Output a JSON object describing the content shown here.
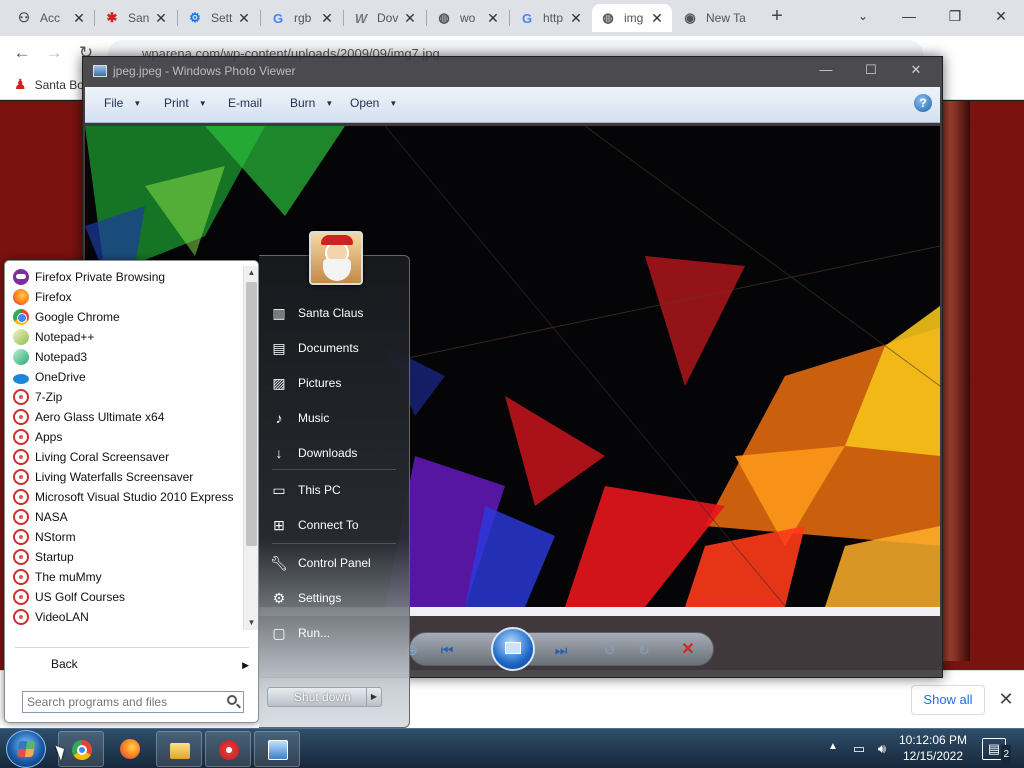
{
  "browser": {
    "tabs": [
      {
        "label": "Acc",
        "icon": "account-icon"
      },
      {
        "label": "San",
        "icon": "santa-icon"
      },
      {
        "label": "Sett",
        "icon": "settings-gear-icon"
      },
      {
        "label": "rgb",
        "icon": "google-icon"
      },
      {
        "label": "Dov",
        "icon": "wordpress-icon"
      },
      {
        "label": "wo",
        "icon": "globe-icon"
      },
      {
        "label": "http",
        "icon": "google-icon"
      },
      {
        "label": "img",
        "icon": "globe-icon",
        "active": true
      },
      {
        "label": "New Ta",
        "icon": "chrome-icon"
      }
    ],
    "url": "wparena.com/wp-content/uploads/2009/09/img7.jpg",
    "bookmark": "Santa Bo",
    "show_all": "Show all"
  },
  "photo_viewer": {
    "title": "jpeg.jpeg - Windows Photo Viewer",
    "menus": [
      "File",
      "Print",
      "E-mail",
      "Burn",
      "Open"
    ],
    "help": "?"
  },
  "start_menu": {
    "programs": [
      {
        "label": "Firefox Private Browsing",
        "icon": "pi-private"
      },
      {
        "label": "Firefox",
        "icon": "pi-firefox"
      },
      {
        "label": "Google Chrome",
        "icon": "pi-chrome"
      },
      {
        "label": "Notepad++",
        "icon": "pi-npp"
      },
      {
        "label": "Notepad3",
        "icon": "pi-np3"
      },
      {
        "label": "OneDrive",
        "icon": "pi-onedrive"
      },
      {
        "label": "7-Zip",
        "icon": "pi-folder"
      },
      {
        "label": "Aero Glass Ultimate x64",
        "icon": "pi-folder"
      },
      {
        "label": "Apps",
        "icon": "pi-folder"
      },
      {
        "label": "Living Coral Screensaver",
        "icon": "pi-folder"
      },
      {
        "label": "Living Waterfalls Screensaver",
        "icon": "pi-folder"
      },
      {
        "label": "Microsoft Visual Studio 2010 Express",
        "icon": "pi-folder"
      },
      {
        "label": "NASA",
        "icon": "pi-folder"
      },
      {
        "label": "NStorm",
        "icon": "pi-folder"
      },
      {
        "label": "Startup",
        "icon": "pi-folder"
      },
      {
        "label": "The muMmy",
        "icon": "pi-folder"
      },
      {
        "label": "US Golf Courses",
        "icon": "pi-folder"
      },
      {
        "label": "VideoLAN",
        "icon": "pi-folder"
      }
    ],
    "back": "Back",
    "search_placeholder": "Search programs and files",
    "links": {
      "user": "Santa Claus",
      "documents": "Documents",
      "pictures": "Pictures",
      "music": "Music",
      "downloads": "Downloads",
      "this_pc": "This PC",
      "connect_to": "Connect To",
      "control_panel": "Control Panel",
      "settings": "Settings",
      "run": "Run..."
    },
    "shutdown": "Shut down"
  },
  "taskbar": {
    "time": "10:12:06 PM",
    "date": "12/15/2022",
    "notifications": "2"
  }
}
